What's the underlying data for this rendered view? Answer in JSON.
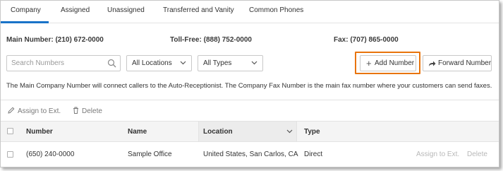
{
  "tabs": [
    {
      "label": "Company"
    },
    {
      "label": "Assigned"
    },
    {
      "label": "Unassigned"
    },
    {
      "label": "Transferred and Vanity"
    },
    {
      "label": "Common Phones"
    }
  ],
  "active_tab": "Company",
  "numbers": {
    "main_label": "Main Number:",
    "main_value": "(210) 672-0000",
    "tollfree_label": "Toll-Free:",
    "tollfree_value": "(888) 752-0000",
    "fax_label": "Fax:",
    "fax_value": "(707) 865-0000"
  },
  "filters": {
    "search_placeholder": "Search Numbers",
    "location_selected": "All Locations",
    "type_selected": "All Types"
  },
  "buttons": {
    "add_number": "Add Number",
    "forward_number": "Forward Number"
  },
  "description": "The Main Company Number will connect callers to the Auto-Receptionist. The Company Fax Number is the main fax number where your customers can send faxes.",
  "bulk_actions": {
    "assign": "Assign to Ext.",
    "delete": "Delete"
  },
  "table": {
    "columns": [
      "Number",
      "Name",
      "Location",
      "Type"
    ],
    "rows": [
      {
        "number": "(650) 240-0000",
        "name": "Sample Office",
        "location": "United States, San Carlos, CA",
        "type": "Direct",
        "action_assign": "Assign to Ext.",
        "action_delete": "Delete"
      }
    ]
  },
  "colors": {
    "accent": "#1a73c8",
    "highlight": "#e8740c"
  }
}
